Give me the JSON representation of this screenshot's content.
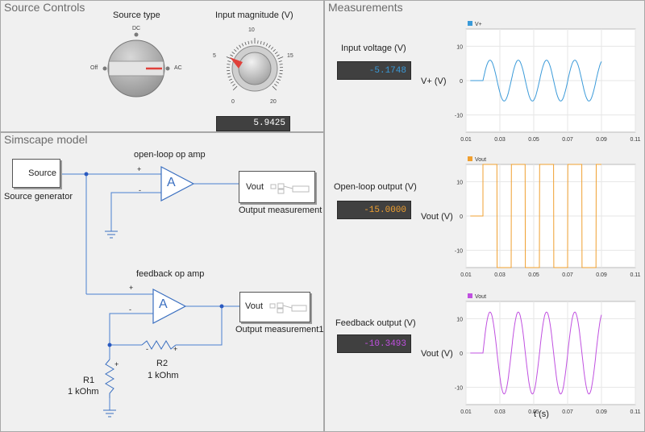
{
  "panels": {
    "source_controls": "Source Controls",
    "simscape_model": "Simscape model",
    "measurements": "Measurements"
  },
  "source_type": {
    "label": "Source type",
    "options": {
      "dc": "DC",
      "off": "Off",
      "ac": "AC"
    },
    "selected": "AC"
  },
  "input_magnitude": {
    "label": "Input magnitude (V)",
    "ticks": [
      "0",
      "5",
      "10",
      "15",
      "20"
    ],
    "value_display": "5.9425",
    "value": 5.9425
  },
  "model": {
    "source_block": "Source",
    "source_caption": "Source generator",
    "openloop_caption": "open-loop op amp",
    "feedback_caption": "feedback op amp",
    "opamp_symbol": "A",
    "plus": "+",
    "minus": "-",
    "vout_block1": "Vout",
    "vout_caption1": "Output measurement",
    "vout_block2": "Vout",
    "vout_caption2": "Output measurement1",
    "r1_name": "R1",
    "r1_value": "1 kOhm",
    "r2_name": "R2",
    "r2_value": "1 kOhm"
  },
  "measurements": {
    "input_voltage": {
      "label": "Input voltage (V)",
      "value": "-5.1748",
      "color": "#3a9ad9"
    },
    "openloop_output": {
      "label": "Open-loop output (V)",
      "value": "-15.0000",
      "color": "#f0a030"
    },
    "feedback_output": {
      "label": "Feedback output (V)",
      "value": "-10.3493",
      "color": "#c050e0"
    },
    "x_axis_label": "t (s)"
  },
  "chart_data": [
    {
      "type": "line",
      "legend": "V+",
      "ylabel": "V+ (V)",
      "color": "#3a9ad9",
      "xlim": [
        0.01,
        0.11
      ],
      "ylim": [
        -15,
        15
      ],
      "xticks": [
        "0.01",
        "0.03",
        "0.05",
        "0.07",
        "0.09",
        "0.11"
      ],
      "yticks": [
        "10",
        "0",
        "-10"
      ],
      "series": [
        {
          "name": "V+",
          "signal": "sine",
          "amplitude": 5.94,
          "period": 0.0167,
          "start": 0.02,
          "end": 0.09
        }
      ]
    },
    {
      "type": "line",
      "legend": "Vout",
      "ylabel": "Vout (V)",
      "color": "#f0a030",
      "xlim": [
        0.01,
        0.11
      ],
      "ylim": [
        -15,
        15
      ],
      "xticks": [
        "0.01",
        "0.03",
        "0.05",
        "0.07",
        "0.09",
        "0.11"
      ],
      "yticks": [
        "10",
        "0",
        "-10"
      ],
      "series": [
        {
          "name": "Vout",
          "signal": "square",
          "amplitude": 15,
          "period": 0.0167,
          "start": 0.02,
          "end": 0.09
        }
      ]
    },
    {
      "type": "line",
      "legend": "Vout",
      "ylabel": "Vout (V)",
      "color": "#c050e0",
      "xlim": [
        0.01,
        0.11
      ],
      "ylim": [
        -15,
        15
      ],
      "xticks": [
        "0.01",
        "0.03",
        "0.05",
        "0.07",
        "0.09",
        "0.11"
      ],
      "yticks": [
        "10",
        "0",
        "-10"
      ],
      "series": [
        {
          "name": "Vout",
          "signal": "sine",
          "amplitude": 11.9,
          "period": 0.0167,
          "start": 0.02,
          "end": 0.09
        }
      ]
    }
  ]
}
